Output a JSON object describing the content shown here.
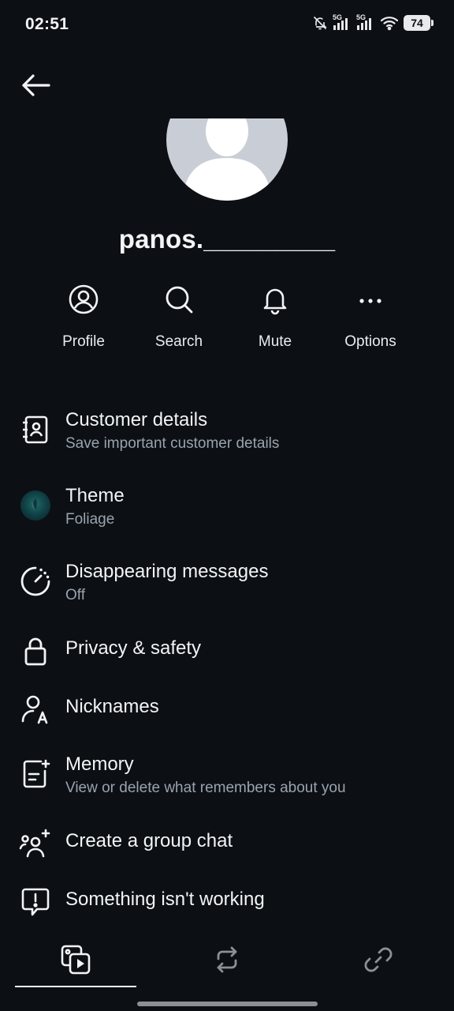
{
  "status": {
    "time": "02:51",
    "battery": "74",
    "network_1": "5G",
    "network_2": "5G"
  },
  "header": {
    "username": "panos._________"
  },
  "actions": [
    {
      "label": "Profile",
      "icon": "profile-icon"
    },
    {
      "label": "Search",
      "icon": "search-icon"
    },
    {
      "label": "Mute",
      "icon": "bell-icon"
    },
    {
      "label": "Options",
      "icon": "more-dots-icon"
    }
  ],
  "menu": {
    "customer_details": {
      "title": "Customer details",
      "subtitle": "Save important customer details",
      "icon": "contact-book-icon"
    },
    "theme": {
      "title": "Theme",
      "subtitle": "Foliage",
      "icon": "theme-swatch-icon"
    },
    "disappearing": {
      "title": "Disappearing messages",
      "subtitle": "Off",
      "icon": "timer-icon"
    },
    "privacy": {
      "title": "Privacy & safety",
      "icon": "lock-icon"
    },
    "nicknames": {
      "title": "Nicknames",
      "icon": "nickname-icon"
    },
    "memory": {
      "title": "Memory",
      "subtitle": "View or delete what  remembers about you",
      "icon": "memory-note-icon"
    },
    "group_chat": {
      "title": "Create a group chat",
      "icon": "add-group-icon"
    },
    "report": {
      "title": "Something isn't working",
      "icon": "report-problem-icon"
    }
  },
  "tabs": [
    {
      "icon": "media-icon",
      "selected": true
    },
    {
      "icon": "repost-icon",
      "selected": false
    },
    {
      "icon": "link-icon",
      "selected": false
    }
  ],
  "colors": {
    "background": "#0c1014",
    "text": "#f2f4f6",
    "subtext": "#9aa3ad"
  }
}
